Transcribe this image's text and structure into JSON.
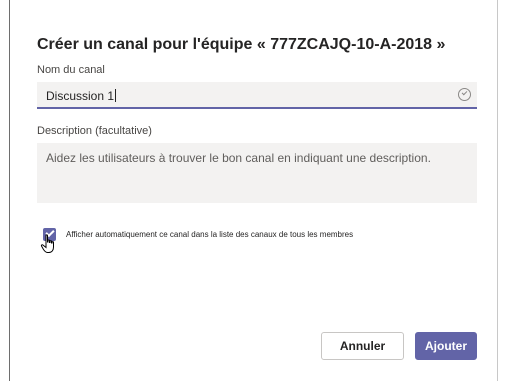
{
  "dialog": {
    "title": "Créer un canal pour l'équipe « 777ZCAJQ-10-A-2018 »"
  },
  "channel_name": {
    "label": "Nom du canal",
    "value": "Discussion 1",
    "valid_icon": "check-circle-icon"
  },
  "description": {
    "label": "Description (facultative)",
    "placeholder": "Aidez les utilisateurs à trouver le bon canal en indiquant une description."
  },
  "auto_show": {
    "checked": true,
    "label": "Afficher automatiquement ce canal dans la liste des canaux de tous les membres"
  },
  "buttons": {
    "cancel": "Annuler",
    "add": "Ajouter"
  },
  "colors": {
    "accent": "#6264a7",
    "field_bg": "#f3f2f1"
  }
}
